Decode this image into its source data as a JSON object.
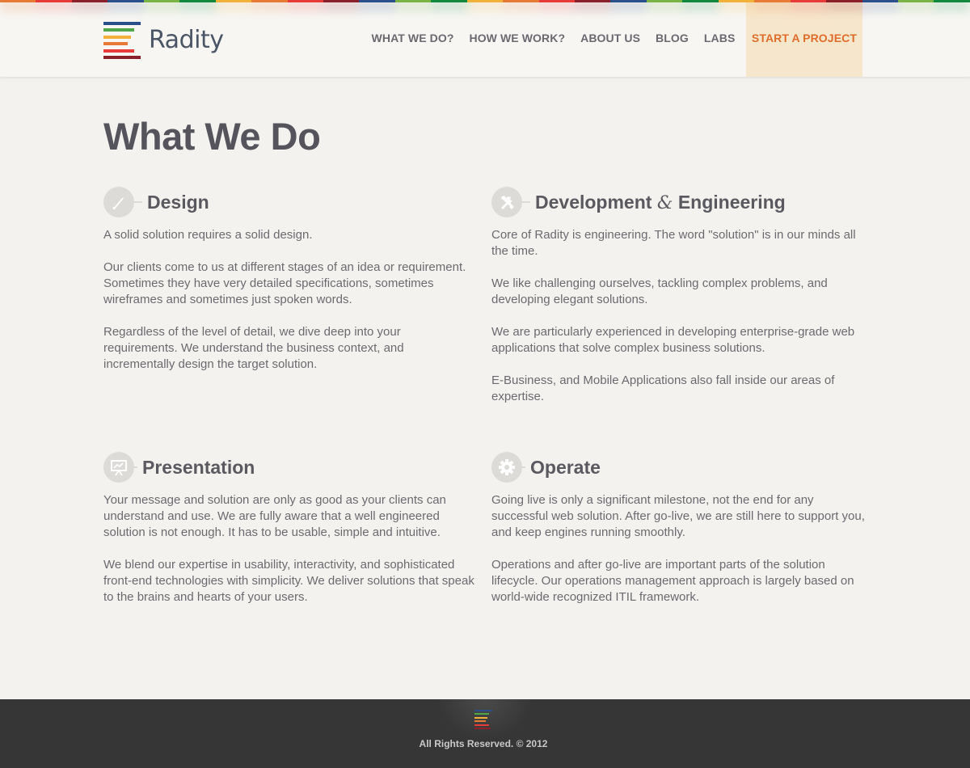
{
  "colors": {
    "stripe": [
      "#e77a35",
      "#e63b39",
      "#8a2029",
      "#2b4f8a",
      "#79b445",
      "#11883e",
      "#f2b23a",
      "#e77a35",
      "#e63b39",
      "#8a2029",
      "#2b4f8a",
      "#79b445",
      "#11883e",
      "#f2b23a",
      "#e77a35",
      "#e63b39",
      "#8a2029",
      "#2b4f8a",
      "#79b445",
      "#11883e",
      "#f2b23a",
      "#e77a35",
      "#e63b39",
      "#8a2029",
      "#2b4f8a",
      "#79b445",
      "#11883e"
    ],
    "logo_bars": [
      "#2b4f8a",
      "#4fa64a",
      "#f2b23a",
      "#e77a35",
      "#e63b39",
      "#8a2029"
    ],
    "accent": "#e06c2c",
    "cta_bg": "#f6e6cc"
  },
  "header": {
    "logo_text": "Radity",
    "nav": [
      {
        "label": "WHAT WE DO?"
      },
      {
        "label": "HOW WE WORK?"
      },
      {
        "label": "ABOUT US"
      },
      {
        "label": "BLOG"
      },
      {
        "label": "LABS"
      },
      {
        "label": "START A PROJECT"
      }
    ]
  },
  "main": {
    "title": "What We Do",
    "sections": [
      {
        "icon": "brush-icon",
        "title": "Design",
        "paragraphs": [
          "A solid solution requires a solid design.",
          "Our clients come to us at different stages of an idea or requirement. Sometimes they have very detailed specifications, sometimes wireframes and sometimes just spoken words.",
          "Regardless of the level of detail, we dive deep into your requirements. We understand the business context, and incrementally design the target solution."
        ]
      },
      {
        "icon": "tools-icon",
        "title_part1": "Development",
        "title_amp": "&",
        "title_part2": "Engineering",
        "paragraphs": [
          "Core of Radity is engineering. The word \"solution\" is in our minds all the time.",
          "We like challenging ourselves, tackling complex problems, and developing elegant solutions.",
          "We are particularly experienced in developing enterprise-grade web applications that solve complex business solutions.",
          "E-Business, and Mobile Applications also fall inside our areas of expertise."
        ]
      },
      {
        "icon": "presentation-icon",
        "title": "Presentation",
        "paragraphs": [
          "Your message and solution are only as good as your clients can understand and use. We are fully aware that a well engineered solution is not enough. It has to be usable, simple and intuitive.",
          "We blend our expertise in usability, interactivity, and sophisticated front-end technologies with simplicity. We deliver solutions that speak to the brains and hearts of your users."
        ]
      },
      {
        "icon": "gear-icon",
        "title": "Operate",
        "paragraphs": [
          "Going live is only a significant milestone, not the end for any successful web solution. After go-live, we are still here to support you, and keep engines running smoothly.",
          "Operations and after go-live are important parts of the solution lifecycle. Our operations management approach is largely based on world-wide recognized ITIL framework."
        ]
      }
    ]
  },
  "footer": {
    "copyright": "All Rights Reserved. © 2012"
  }
}
